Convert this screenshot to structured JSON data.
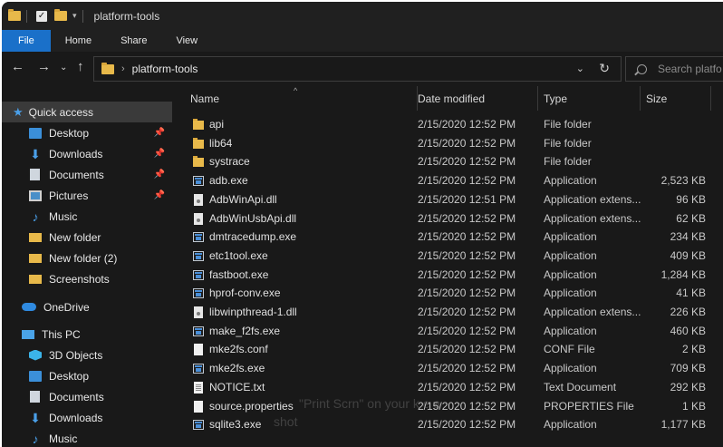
{
  "window": {
    "title": "platform-tools",
    "quick_access_toolbar": [
      "folder-icon",
      "properties-check-icon",
      "new-folder-icon",
      "customize-arrow-icon"
    ]
  },
  "ribbon": {
    "tabs": [
      {
        "label": "File",
        "active": true
      },
      {
        "label": "Home",
        "active": false
      },
      {
        "label": "Share",
        "active": false
      },
      {
        "label": "View",
        "active": false
      }
    ],
    "accent_color": "#1a70c9"
  },
  "address": {
    "path": "platform-tools",
    "search_placeholder": "Search platfo"
  },
  "nav_pane": {
    "quick_access": {
      "label": "Quick access",
      "selected": true
    },
    "pinned": [
      {
        "label": "Desktop",
        "icon": "desktop-icon",
        "pinned": true
      },
      {
        "label": "Downloads",
        "icon": "downloads-icon",
        "pinned": true
      },
      {
        "label": "Documents",
        "icon": "documents-icon",
        "pinned": true
      },
      {
        "label": "Pictures",
        "icon": "pictures-icon",
        "pinned": true
      },
      {
        "label": "Music",
        "icon": "music-icon",
        "pinned": false
      },
      {
        "label": "New folder",
        "icon": "folder-icon",
        "pinned": false
      },
      {
        "label": "New folder (2)",
        "icon": "folder-icon",
        "pinned": false
      },
      {
        "label": "Screenshots",
        "icon": "folder-icon",
        "pinned": false
      }
    ],
    "onedrive": {
      "label": "OneDrive"
    },
    "this_pc": {
      "label": "This PC",
      "items": [
        {
          "label": "3D Objects",
          "icon": "3d-objects-icon"
        },
        {
          "label": "Desktop",
          "icon": "desktop-icon"
        },
        {
          "label": "Documents",
          "icon": "documents-icon"
        },
        {
          "label": "Downloads",
          "icon": "downloads-icon"
        },
        {
          "label": "Music",
          "icon": "music-icon"
        }
      ]
    }
  },
  "columns": {
    "name": "Name",
    "date": "Date modified",
    "type": "Type",
    "size": "Size"
  },
  "files": [
    {
      "name": "api",
      "date": "2/15/2020 12:52 PM",
      "type": "File folder",
      "size": "",
      "icon": "folder"
    },
    {
      "name": "lib64",
      "date": "2/15/2020 12:52 PM",
      "type": "File folder",
      "size": "",
      "icon": "folder"
    },
    {
      "name": "systrace",
      "date": "2/15/2020 12:52 PM",
      "type": "File folder",
      "size": "",
      "icon": "folder"
    },
    {
      "name": "adb.exe",
      "date": "2/15/2020 12:52 PM",
      "type": "Application",
      "size": "2,523 KB",
      "icon": "exe"
    },
    {
      "name": "AdbWinApi.dll",
      "date": "2/15/2020 12:51 PM",
      "type": "Application extens...",
      "size": "96 KB",
      "icon": "dll"
    },
    {
      "name": "AdbWinUsbApi.dll",
      "date": "2/15/2020 12:52 PM",
      "type": "Application extens...",
      "size": "62 KB",
      "icon": "dll"
    },
    {
      "name": "dmtracedump.exe",
      "date": "2/15/2020 12:52 PM",
      "type": "Application",
      "size": "234 KB",
      "icon": "exe"
    },
    {
      "name": "etc1tool.exe",
      "date": "2/15/2020 12:52 PM",
      "type": "Application",
      "size": "409 KB",
      "icon": "exe"
    },
    {
      "name": "fastboot.exe",
      "date": "2/15/2020 12:52 PM",
      "type": "Application",
      "size": "1,284 KB",
      "icon": "exe"
    },
    {
      "name": "hprof-conv.exe",
      "date": "2/15/2020 12:52 PM",
      "type": "Application",
      "size": "41 KB",
      "icon": "exe"
    },
    {
      "name": "libwinpthread-1.dll",
      "date": "2/15/2020 12:52 PM",
      "type": "Application extens...",
      "size": "226 KB",
      "icon": "dll"
    },
    {
      "name": "make_f2fs.exe",
      "date": "2/15/2020 12:52 PM",
      "type": "Application",
      "size": "460 KB",
      "icon": "exe"
    },
    {
      "name": "mke2fs.conf",
      "date": "2/15/2020 12:52 PM",
      "type": "CONF File",
      "size": "2 KB",
      "icon": "doc"
    },
    {
      "name": "mke2fs.exe",
      "date": "2/15/2020 12:52 PM",
      "type": "Application",
      "size": "709 KB",
      "icon": "exe"
    },
    {
      "name": "NOTICE.txt",
      "date": "2/15/2020 12:52 PM",
      "type": "Text Document",
      "size": "292 KB",
      "icon": "txt"
    },
    {
      "name": "source.properties",
      "date": "2/15/2020 12:52 PM",
      "type": "PROPERTIES File",
      "size": "1 KB",
      "icon": "doc"
    },
    {
      "name": "sqlite3.exe",
      "date": "2/15/2020 12:52 PM",
      "type": "Application",
      "size": "1,177 KB",
      "icon": "exe"
    }
  ],
  "overlay": {
    "line1": "\"Print Scrn\" on your k                e a",
    "line2": "shot"
  }
}
